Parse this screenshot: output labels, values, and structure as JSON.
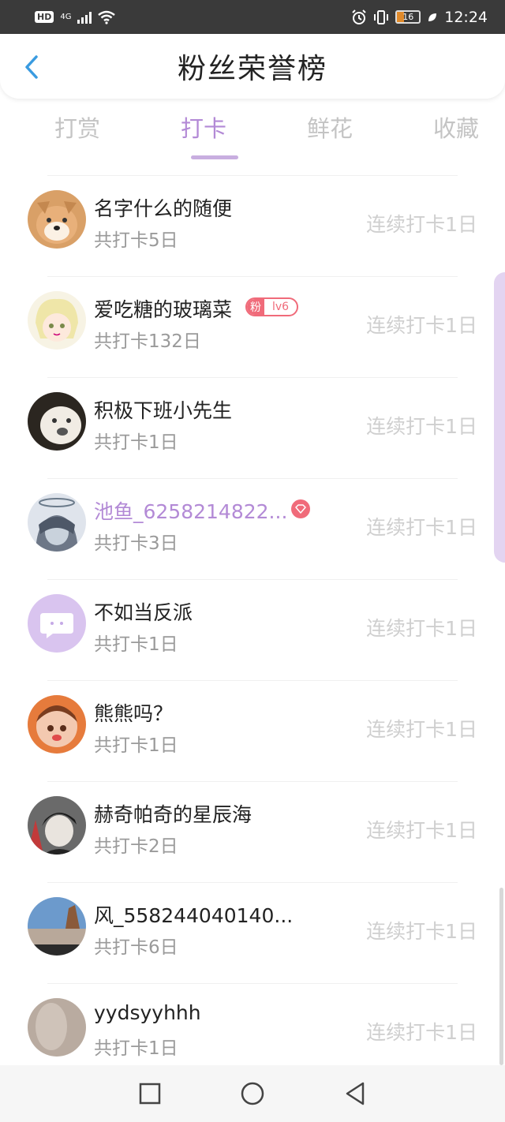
{
  "status_bar": {
    "hd": "HD",
    "network": "4G",
    "battery": "16",
    "time": "12:24"
  },
  "header": {
    "title": "粉丝荣誉榜"
  },
  "tabs": [
    {
      "label": "打赏"
    },
    {
      "label": "打卡"
    },
    {
      "label": "鲜花"
    },
    {
      "label": "收藏"
    }
  ],
  "active_tab": "打卡",
  "rows": [
    {
      "name": "名字什么的随便",
      "count": "共打卡5日",
      "streak": "连续打卡1日"
    },
    {
      "name": "爱吃糖的玻璃菜",
      "count": "共打卡132日",
      "streak": "连续打卡1日",
      "fan_badge": "粉",
      "level": "lv6"
    },
    {
      "name": "积极下班小先生",
      "count": "共打卡1日",
      "streak": "连续打卡1日"
    },
    {
      "name": "池鱼_6258214822...",
      "count": "共打卡3日",
      "streak": "连续打卡1日"
    },
    {
      "name": "不如当反派",
      "count": "共打卡1日",
      "streak": "连续打卡1日"
    },
    {
      "name": "熊熊吗？",
      "count": "共打卡1日",
      "streak": "连续打卡1日"
    },
    {
      "name": "赫奇帕奇的星辰海",
      "count": "共打卡2日",
      "streak": "连续打卡1日"
    },
    {
      "name": "风_558244040140...",
      "count": "共打卡6日",
      "streak": "连续打卡1日"
    },
    {
      "name": "yydsyyhhh",
      "count": "共打卡1日",
      "streak": "连续打卡1日"
    }
  ],
  "colors": {
    "accent": "#b38ad6",
    "badge": "#f06b7a",
    "muted": "#cfcfcf"
  }
}
